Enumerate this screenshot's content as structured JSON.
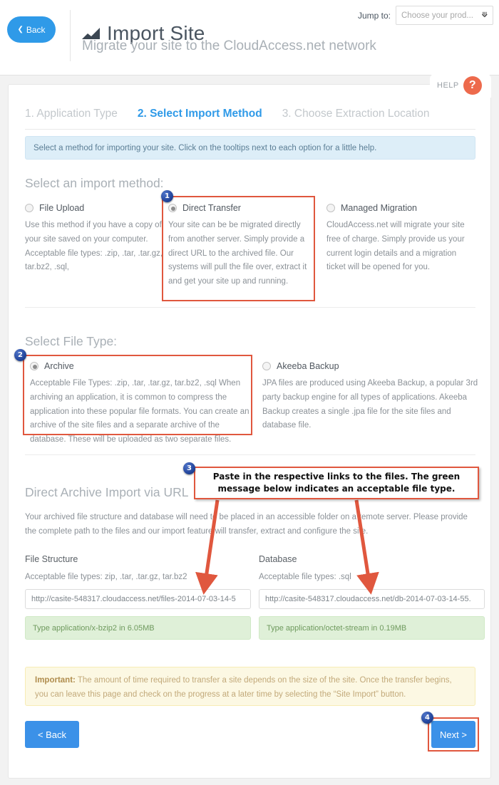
{
  "header": {
    "back_label": "Back",
    "title": "Import Site",
    "subtitle": "Migrate your site to the CloudAccess.net network",
    "jump_to_label": "Jump to:",
    "jump_to_value": "Choose your prod...",
    "help_label": "HELP",
    "help_mark": "?"
  },
  "steps": [
    {
      "label": "1. Application Type"
    },
    {
      "label": "2. Select Import Method"
    },
    {
      "label": "3. Choose Extraction Location"
    }
  ],
  "info_banner": "Select a method for importing your site. Click on the tooltips next to each option for a little help.",
  "import_method": {
    "heading": "Select an import method:",
    "options": [
      {
        "label": "File Upload",
        "desc": "Use this method if you have a copy of your site saved on your computer. Acceptable file types: .zip, .tar, .tar.gz, tar.bz2, .sql,"
      },
      {
        "label": "Direct Transfer",
        "desc": "Your site can be be migrated directly from another server. Simply provide a direct URL to the archived file. Our systems will pull the file over, extract it and get your site up and running."
      },
      {
        "label": "Managed Migration",
        "desc": "CloudAccess.net will migrate your site free of charge. Simply provide us your current login details and a migration ticket will be opened for you."
      }
    ]
  },
  "file_type": {
    "heading": "Select File Type:",
    "options": [
      {
        "label": "Archive",
        "desc": "Acceptable File Types: .zip, .tar, .tar.gz, tar.bz2, .sql When archiving an application, it is common to compress the application into these popular file formats. You can create an archive of the site files and a separate archive of the database. These will be uploaded as two separate files."
      },
      {
        "label": "Akeeba Backup",
        "desc": "JPA files are produced using Akeeba Backup, a popular 3rd party backup engine for all types of applications. Akeeba Backup creates a single .jpa file for the site files and database file."
      }
    ]
  },
  "url_section": {
    "heading": "Direct Archive Import via URL",
    "desc": "Your archived file structure and database will need to be placed in an accessible folder on a remote server. Please provide the complete path to the files and our import feature will transfer, extract and configure the site.",
    "file_structure": {
      "title": "File Structure",
      "accepts": "Acceptable file types: zip, .tar, .tar.gz, tar.bz2",
      "value": "http://casite-548317.cloudaccess.net/files-2014-07-03-14-5",
      "status": "Type application/x-bzip2 in 6.05MB"
    },
    "database": {
      "title": "Database",
      "accepts": "Acceptable file types: .sql",
      "value": "http://casite-548317.cloudaccess.net/db-2014-07-03-14-55.",
      "status": "Type application/octet-stream in 0.19MB"
    }
  },
  "callout": {
    "line1": "Paste in the respective links to the files. The green",
    "line2": "message below indicates an acceptable file type."
  },
  "important": {
    "label": "Important:",
    "text": " The amount of time required to transfer a site depends on the size of the site. Once the transfer begins, you can leave this page and check on the progress at a later time by selecting the “Site Import” button."
  },
  "footer": {
    "back": "< Back",
    "next": "Next >"
  },
  "annotations": [
    {
      "number": "1"
    },
    {
      "number": "2"
    },
    {
      "number": "3"
    },
    {
      "number": "4"
    }
  ],
  "colors": {
    "accent_blue": "#2f9ae8",
    "highlight_red": "#e0573e",
    "help_orange": "#ed6a4c",
    "badge_blue": "#24479e",
    "success_green": "#dff0d8",
    "warning_yellow": "#fcf8e3"
  }
}
